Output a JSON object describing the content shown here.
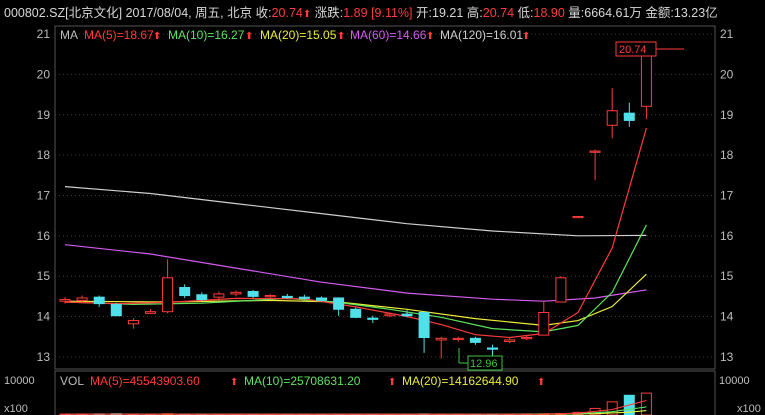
{
  "header": {
    "code": "000802.SZ",
    "name": "[北京文化]",
    "date": "2017/08/04,",
    "weekday": "周五,",
    "city": "北京",
    "close_label": "收:",
    "close": "20.74",
    "change_label": "涨跌:",
    "change": "1.89",
    "pct": "[9.11%]",
    "open_label": "开:",
    "open": "19.21",
    "high_label": "高:",
    "high": "20.74",
    "low_label": "低:",
    "low": "18.90",
    "vol_label": "量:",
    "vol": "6664.61万",
    "amount_label": "金额:",
    "amount": "13.23亿"
  },
  "legend": {
    "ma_label": "MA",
    "ma5": "MA(5)=18.67",
    "ma10": "MA(10)=16.27",
    "ma20": "MA(20)=15.05",
    "ma60": "MA(60)=14.66",
    "ma120": "MA(120)=16.01"
  },
  "vol_legend": {
    "label": "VOL",
    "ma5": "MA(5)=45543903.60",
    "ma10": "MA(10)=25708631.20",
    "ma20": "MA(20)=14162644.90"
  },
  "callouts": {
    "high": "20.74",
    "low": "12.96"
  },
  "colors": {
    "up": "#ff3b3b",
    "down": "#4fe0ea",
    "ma5": "#ff3b3b",
    "ma10": "#5fe35f",
    "ma20": "#ecec3c",
    "ma60": "#d25cf0",
    "ma120": "#cfcfcf",
    "grid": "#3a3a3a"
  },
  "chart_data": {
    "type": "candlestick",
    "y_ticks": [
      "13",
      "14",
      "15",
      "16",
      "17",
      "18",
      "19",
      "20",
      "21"
    ],
    "ylim": [
      12.7,
      21.2
    ],
    "vol_ticks": {
      "top": "10000",
      "unit": "x100"
    },
    "candles": [
      {
        "o": 14.38,
        "h": 14.48,
        "l": 14.32,
        "c": 14.42
      },
      {
        "o": 14.4,
        "h": 14.52,
        "l": 14.36,
        "c": 14.46
      },
      {
        "o": 14.48,
        "h": 14.52,
        "l": 14.24,
        "c": 14.32
      },
      {
        "o": 14.3,
        "h": 14.34,
        "l": 14.02,
        "c": 14.02
      },
      {
        "o": 13.82,
        "h": 13.96,
        "l": 13.7,
        "c": 13.9
      },
      {
        "o": 14.08,
        "h": 14.18,
        "l": 14.06,
        "c": 14.12
      },
      {
        "o": 14.12,
        "h": 15.42,
        "l": 14.08,
        "c": 14.96
      },
      {
        "o": 14.72,
        "h": 14.8,
        "l": 14.46,
        "c": 14.52
      },
      {
        "o": 14.54,
        "h": 14.6,
        "l": 14.38,
        "c": 14.42
      },
      {
        "o": 14.48,
        "h": 14.62,
        "l": 14.4,
        "c": 14.56
      },
      {
        "o": 14.56,
        "h": 14.64,
        "l": 14.5,
        "c": 14.6
      },
      {
        "o": 14.62,
        "h": 14.66,
        "l": 14.46,
        "c": 14.5
      },
      {
        "o": 14.5,
        "h": 14.56,
        "l": 14.44,
        "c": 14.52
      },
      {
        "o": 14.5,
        "h": 14.56,
        "l": 14.44,
        "c": 14.48
      },
      {
        "o": 14.48,
        "h": 14.54,
        "l": 14.42,
        "c": 14.46
      },
      {
        "o": 14.46,
        "h": 14.5,
        "l": 14.36,
        "c": 14.4
      },
      {
        "o": 14.46,
        "h": 14.48,
        "l": 14.02,
        "c": 14.18
      },
      {
        "o": 14.18,
        "h": 14.22,
        "l": 13.96,
        "c": 13.98
      },
      {
        "o": 13.96,
        "h": 14.02,
        "l": 13.84,
        "c": 13.94
      },
      {
        "o": 14.02,
        "h": 14.1,
        "l": 13.98,
        "c": 14.06
      },
      {
        "o": 14.06,
        "h": 14.16,
        "l": 13.98,
        "c": 14.02
      },
      {
        "o": 14.1,
        "h": 14.14,
        "l": 13.1,
        "c": 13.48
      },
      {
        "o": 13.42,
        "h": 13.5,
        "l": 12.96,
        "c": 13.46
      },
      {
        "o": 13.44,
        "h": 13.5,
        "l": 13.38,
        "c": 13.46
      },
      {
        "o": 13.46,
        "h": 13.5,
        "l": 13.3,
        "c": 13.36
      },
      {
        "o": 13.22,
        "h": 13.3,
        "l": 13.02,
        "c": 13.2
      },
      {
        "o": 13.38,
        "h": 13.46,
        "l": 13.34,
        "c": 13.42
      },
      {
        "o": 13.46,
        "h": 13.52,
        "l": 13.42,
        "c": 13.48
      },
      {
        "o": 13.54,
        "h": 14.4,
        "l": 13.54,
        "c": 14.1
      },
      {
        "o": 14.36,
        "h": 15.0,
        "l": 14.36,
        "c": 14.96
      },
      {
        "o": 16.48,
        "h": 16.48,
        "l": 16.48,
        "c": 16.48
      },
      {
        "o": 18.1,
        "h": 18.14,
        "l": 17.38,
        "c": 18.1
      },
      {
        "o": 18.74,
        "h": 19.66,
        "l": 18.42,
        "c": 19.1
      },
      {
        "o": 19.04,
        "h": 19.3,
        "l": 18.7,
        "c": 18.86
      },
      {
        "o": 19.21,
        "h": 20.74,
        "l": 18.9,
        "c": 20.74
      }
    ],
    "ma5": [
      [
        0,
        14.36
      ],
      [
        3,
        14.32
      ],
      [
        6,
        14.35
      ],
      [
        10,
        14.45
      ],
      [
        14,
        14.44
      ],
      [
        17,
        14.24
      ],
      [
        20,
        14.0
      ],
      [
        22,
        13.8
      ],
      [
        24,
        13.55
      ],
      [
        26,
        13.48
      ],
      [
        28,
        13.58
      ],
      [
        30,
        14.1
      ],
      [
        32,
        15.7
      ],
      [
        34,
        18.67
      ]
    ],
    "ma10": [
      [
        0,
        14.36
      ],
      [
        4,
        14.3
      ],
      [
        8,
        14.33
      ],
      [
        13,
        14.45
      ],
      [
        16,
        14.35
      ],
      [
        19,
        14.18
      ],
      [
        22,
        13.98
      ],
      [
        25,
        13.7
      ],
      [
        28,
        13.62
      ],
      [
        30,
        13.78
      ],
      [
        32,
        14.6
      ],
      [
        34,
        16.27
      ]
    ],
    "ma20": [
      [
        0,
        14.38
      ],
      [
        6,
        14.36
      ],
      [
        12,
        14.4
      ],
      [
        16,
        14.36
      ],
      [
        20,
        14.18
      ],
      [
        24,
        13.95
      ],
      [
        28,
        13.78
      ],
      [
        30,
        13.9
      ],
      [
        32,
        14.25
      ],
      [
        34,
        15.05
      ]
    ],
    "ma60": [
      [
        0,
        15.78
      ],
      [
        5,
        15.55
      ],
      [
        10,
        15.2
      ],
      [
        15,
        14.85
      ],
      [
        20,
        14.58
      ],
      [
        25,
        14.43
      ],
      [
        28,
        14.38
      ],
      [
        31,
        14.46
      ],
      [
        34,
        14.66
      ]
    ],
    "ma120": [
      [
        0,
        17.22
      ],
      [
        5,
        17.05
      ],
      [
        10,
        16.8
      ],
      [
        15,
        16.55
      ],
      [
        20,
        16.3
      ],
      [
        25,
        16.12
      ],
      [
        30,
        16.0
      ],
      [
        34,
        16.01
      ]
    ],
    "volumes": [
      4,
      3,
      5,
      6,
      3,
      2,
      6,
      4,
      4,
      3,
      3,
      3,
      3,
      3,
      3,
      3,
      4,
      3,
      3,
      3,
      3,
      5,
      4,
      3,
      3,
      3,
      3,
      3,
      5,
      7,
      12,
      30,
      60,
      90,
      100
    ],
    "vol_ma5": [
      [
        0,
        4
      ],
      [
        20,
        3.5
      ],
      [
        28,
        4
      ],
      [
        30,
        8
      ],
      [
        32,
        25
      ],
      [
        34,
        66
      ]
    ],
    "vol_ma10": [
      [
        0,
        4
      ],
      [
        25,
        3.6
      ],
      [
        30,
        6
      ],
      [
        32,
        15
      ],
      [
        34,
        37
      ]
    ],
    "vol_ma20": [
      [
        0,
        4
      ],
      [
        28,
        3.8
      ],
      [
        31,
        6
      ],
      [
        33,
        13
      ],
      [
        34,
        20
      ]
    ]
  }
}
